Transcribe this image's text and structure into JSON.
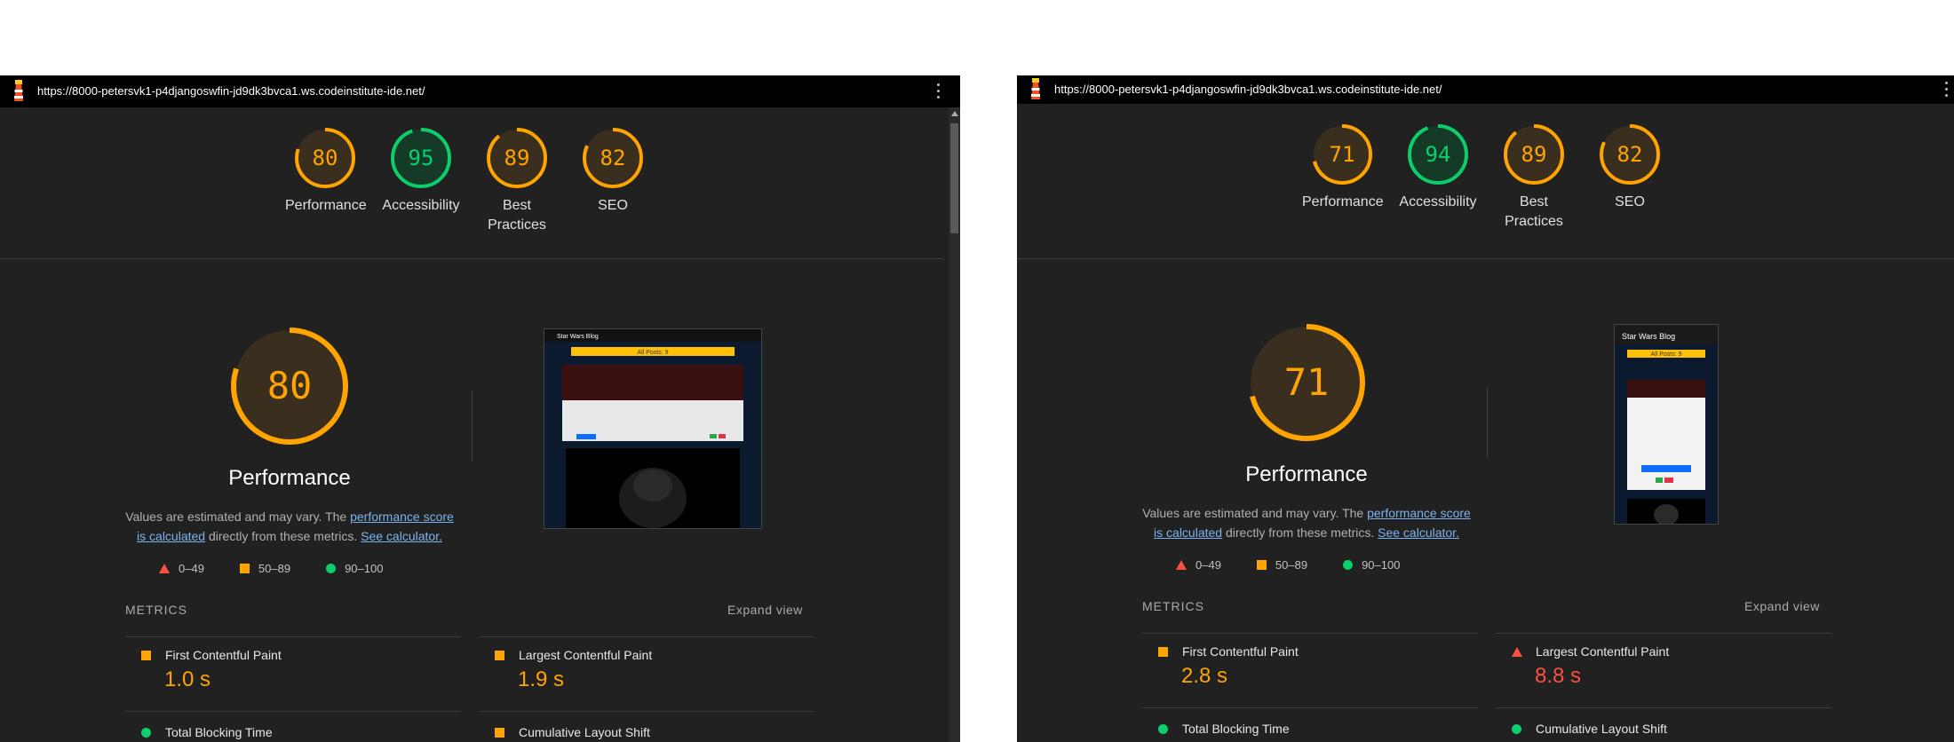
{
  "colors": {
    "pass": "#0cce6b",
    "average": "#ffa400",
    "fail": "#ff4e42",
    "background": "#212121",
    "link": "#7ab4f0"
  },
  "legend": {
    "fail": "0–49",
    "average": "50–89",
    "pass": "90–100"
  },
  "description": {
    "pre": "Values are estimated and may vary. The ",
    "link1": "performance score is calculated",
    "mid": " directly from these metrics. ",
    "link2": "See calculator."
  },
  "metrics_header": "METRICS",
  "expand_label": "Expand view",
  "reports": [
    {
      "url": "https://8000-petersvk1-p4djangoswfin-jd9dk3bvca1.ws.codeinstitute-ide.net/",
      "device": "desktop",
      "scores": [
        {
          "label": "Performance",
          "value": 80,
          "status": "average"
        },
        {
          "label": "Accessibility",
          "value": 95,
          "status": "pass"
        },
        {
          "label": "Best Practices",
          "value": 89,
          "status": "average"
        },
        {
          "label": "SEO",
          "value": 82,
          "status": "average"
        }
      ],
      "performance": {
        "score": 80,
        "title": "Performance"
      },
      "metrics": [
        {
          "name": "First Contentful Paint",
          "value": "1.0 s",
          "status": "average"
        },
        {
          "name": "Largest Contentful Paint",
          "value": "1.9 s",
          "status": "average"
        },
        {
          "name": "Total Blocking Time",
          "value": "",
          "status": "pass"
        },
        {
          "name": "Cumulative Layout Shift",
          "value": "",
          "status": "average"
        }
      ],
      "thumbnail": {
        "site_title": "Star Wars Blog",
        "banner": "All Posts: 9"
      }
    },
    {
      "url": "https://8000-petersvk1-p4djangoswfin-jd9dk3bvca1.ws.codeinstitute-ide.net/",
      "device": "mobile",
      "scores": [
        {
          "label": "Performance",
          "value": 71,
          "status": "average"
        },
        {
          "label": "Accessibility",
          "value": 94,
          "status": "pass"
        },
        {
          "label": "Best Practices",
          "value": 89,
          "status": "average"
        },
        {
          "label": "SEO",
          "value": 82,
          "status": "average"
        }
      ],
      "performance": {
        "score": 71,
        "title": "Performance"
      },
      "metrics": [
        {
          "name": "First Contentful Paint",
          "value": "2.8 s",
          "status": "average"
        },
        {
          "name": "Largest Contentful Paint",
          "value": "8.8 s",
          "status": "fail"
        },
        {
          "name": "Total Blocking Time",
          "value": "",
          "status": "pass"
        },
        {
          "name": "Cumulative Layout Shift",
          "value": "",
          "status": "pass"
        }
      ],
      "thumbnail": {
        "site_title": "Star Wars Blog",
        "banner": "All Posts: 9"
      }
    }
  ]
}
